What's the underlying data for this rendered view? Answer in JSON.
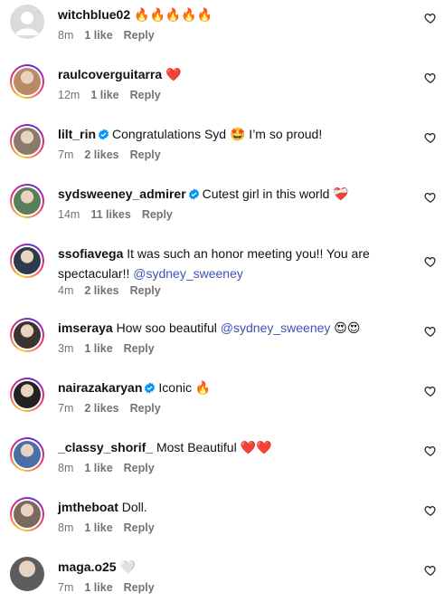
{
  "comments": [
    {
      "username": "witchblue02",
      "verified": false,
      "text": " 🔥🔥🔥🔥🔥",
      "mention": "",
      "after": "",
      "time": "8m",
      "likes": "1 like",
      "reply": "Reply",
      "avatar": "default",
      "avatar_color": "#c7c7cc"
    },
    {
      "username": "raulcoverguitarra",
      "verified": false,
      "text": " ❤️",
      "mention": "",
      "after": "",
      "time": "12m",
      "likes": "1 like",
      "reply": "Reply",
      "avatar": "ring",
      "avatar_color": "#b98a68"
    },
    {
      "username": "lilt_rin",
      "verified": true,
      "text": "Congratulations Syd 🤩 I’m so proud!",
      "mention": "",
      "after": "",
      "time": "7m",
      "likes": "2 likes",
      "reply": "Reply",
      "avatar": "ring",
      "avatar_color": "#8b7a6a"
    },
    {
      "username": "sydsweeney_admirer",
      "verified": true,
      "text": "Cutest girl in this world ❤️‍🩹",
      "mention": "",
      "after": "",
      "time": "14m",
      "likes": "11 likes",
      "reply": "Reply",
      "avatar": "ring",
      "avatar_color": "#5a7d5a"
    },
    {
      "username": "ssofiavega",
      "verified": false,
      "text": " It was such an honor meeting you!! You are spectacular!! ",
      "mention": "@sydney_sweeney",
      "after": "",
      "time": "4m",
      "likes": "2 likes",
      "reply": "Reply",
      "avatar": "ring",
      "avatar_color": "#2d3a4a"
    },
    {
      "username": "imseraya",
      "verified": false,
      "text": " How soo beautiful ",
      "mention": "@sydney_sweeney",
      "after": " 😍😍",
      "time": "3m",
      "likes": "1 like",
      "reply": "Reply",
      "avatar": "ring",
      "avatar_color": "#3b3330"
    },
    {
      "username": "nairazakaryan",
      "verified": true,
      "text": "Iconic 🔥",
      "mention": "",
      "after": "",
      "time": "7m",
      "likes": "2 likes",
      "reply": "Reply",
      "avatar": "ring",
      "avatar_color": "#222222"
    },
    {
      "username": "_classy_shorif_",
      "verified": false,
      "text": " Most Beautiful ❤️❤️",
      "mention": "",
      "after": "",
      "time": "8m",
      "likes": "1 like",
      "reply": "Reply",
      "avatar": "ring",
      "avatar_color": "#4a6fa5"
    },
    {
      "username": "jmtheboat",
      "verified": false,
      "text": " Doll.",
      "mention": "",
      "after": "",
      "time": "8m",
      "likes": "1 like",
      "reply": "Reply",
      "avatar": "ring",
      "avatar_color": "#7a6a5a"
    },
    {
      "username": "maga.o25",
      "verified": false,
      "text": " 🤍",
      "mention": "",
      "after": "",
      "time": "7m",
      "likes": "1 like",
      "reply": "Reply",
      "avatar": "plain",
      "avatar_color": "#5c5c5c"
    }
  ],
  "icons": {
    "like": "heart-outline-icon",
    "verified": "verified-badge-icon"
  },
  "colors": {
    "verified": "#0095f6",
    "mention": "#3f51b5",
    "meta": "#737373"
  }
}
